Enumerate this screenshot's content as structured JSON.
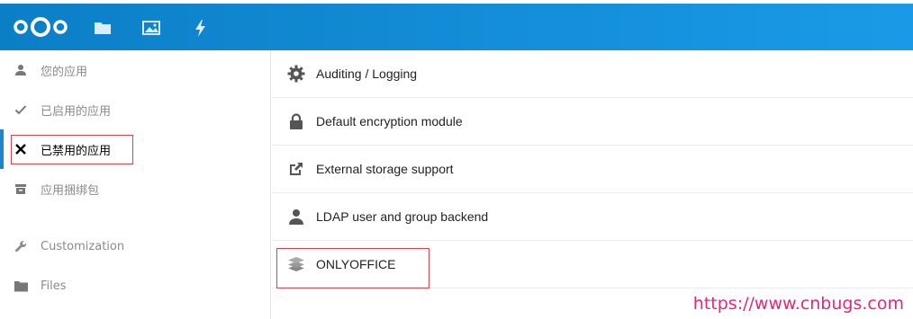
{
  "header": {
    "logo": "nextcloud-logo",
    "icons": [
      "folder-icon",
      "image-icon",
      "lightning-icon"
    ],
    "bg_start": "#0b7fc6",
    "bg_end": "#1a9ae6"
  },
  "sidebar": {
    "items": [
      {
        "label": "您的应用",
        "icon": "user-icon"
      },
      {
        "label": "已启用的应用",
        "icon": "check-icon"
      },
      {
        "label": "已禁用的应用",
        "icon": "x-icon",
        "active": true
      },
      {
        "label": "应用捆绑包",
        "icon": "archive-icon"
      },
      {
        "label": "Customization",
        "icon": "wrench-icon"
      },
      {
        "label": "Files",
        "icon": "folder-icon"
      }
    ],
    "accent": "#1b86cf"
  },
  "apps": [
    {
      "name": "Auditing / Logging",
      "icon": "gear-icon"
    },
    {
      "name": "Default encryption module",
      "icon": "lock-icon"
    },
    {
      "name": "External storage support",
      "icon": "external-link-icon"
    },
    {
      "name": "LDAP user and group backend",
      "icon": "user-icon"
    },
    {
      "name": "ONLYOFFICE",
      "icon": "layers-icon"
    }
  ],
  "highlight_color": "#d0474f",
  "watermark": "https://www.cnbugs.com"
}
